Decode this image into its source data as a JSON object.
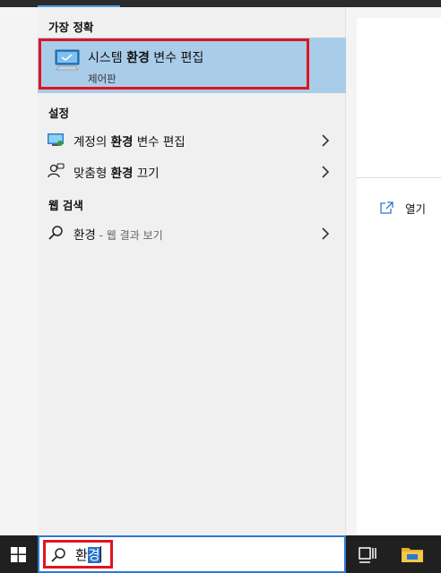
{
  "search_panel": {
    "best_match_header": "가장 정확",
    "best_match": {
      "title_before": "시스템 ",
      "title_bold": "환경",
      "title_after": " 변수 편집",
      "subtitle": "제어판",
      "icon": "monitor-icon"
    },
    "settings_header": "설정",
    "settings_items": [
      {
        "before": "계정의 ",
        "bold": "환경",
        "after": " 변수 편집",
        "icon": "user-account-icon"
      },
      {
        "before": "맞춤형 ",
        "bold": "환경",
        "after": " 끄기",
        "icon": "person-chat-icon"
      }
    ],
    "web_header": "웹 검색",
    "web_item": {
      "query": "환경",
      "suffix": " - 웹 결과 보기",
      "icon": "search-icon"
    }
  },
  "preview": {
    "open_label": "열기",
    "open_icon": "open-external-icon"
  },
  "taskbar": {
    "search_query_plain": "환",
    "search_query_selected": "경"
  },
  "colors": {
    "highlight": "#a9cce9",
    "annotation_red": "#e0141e",
    "taskbar": "#202020",
    "selection": "#2672c9"
  }
}
